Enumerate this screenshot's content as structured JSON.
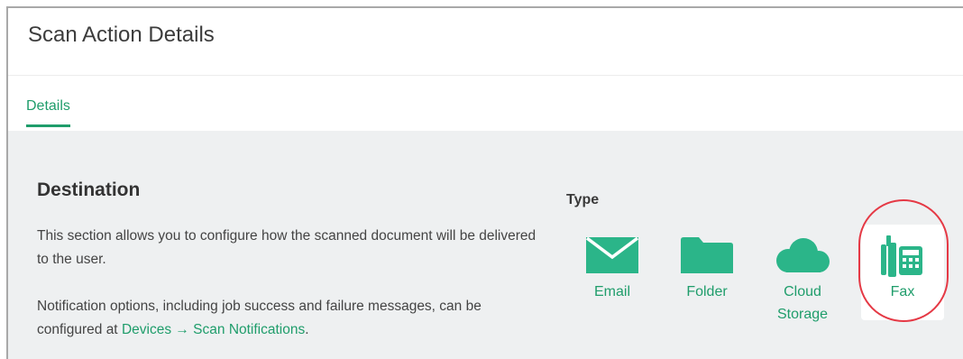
{
  "header": {
    "title": "Scan Action Details"
  },
  "tabs": [
    {
      "label": "Details",
      "active": true
    }
  ],
  "destination": {
    "title": "Destination",
    "description": "This section allows you to configure how the scanned document will be delivered to the user.",
    "notification_text": "Notification options, including job success and failure messages, can be configured at ",
    "notification_link": "Devices → Scan Notifications",
    "notification_end": "."
  },
  "type": {
    "label": "Type",
    "options": [
      {
        "label": "Email",
        "icon": "envelope-icon"
      },
      {
        "label": "Folder",
        "icon": "folder-icon"
      },
      {
        "label": "Cloud Storage",
        "icon": "cloud-icon"
      },
      {
        "label": "Fax",
        "icon": "fax-icon",
        "selected": true
      }
    ]
  },
  "colors": {
    "accent": "#1f9d6b",
    "icon_fill": "#2bb589",
    "content_bg": "#eef0f1",
    "highlight": "#e53945"
  }
}
